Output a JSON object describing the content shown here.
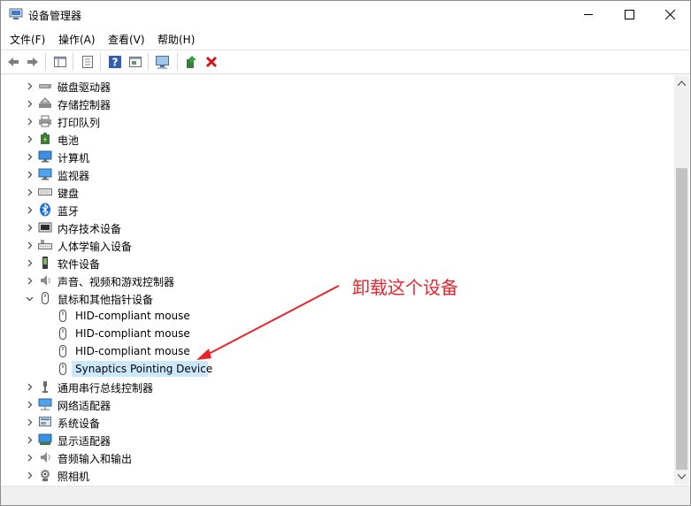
{
  "window": {
    "title": "设备管理器"
  },
  "menu": [
    {
      "label": "文件(F)"
    },
    {
      "label": "操作(A)"
    },
    {
      "label": "查看(V)"
    },
    {
      "label": "帮助(H)"
    }
  ],
  "tree": [
    {
      "label": "磁盘驱动器",
      "icon": "disk-icon",
      "level": 0,
      "expander": "collapsed"
    },
    {
      "label": "存储控制器",
      "icon": "storage-controller-icon",
      "level": 0,
      "expander": "collapsed"
    },
    {
      "label": "打印队列",
      "icon": "printer-icon",
      "level": 0,
      "expander": "collapsed"
    },
    {
      "label": "电池",
      "icon": "battery-icon",
      "level": 0,
      "expander": "collapsed"
    },
    {
      "label": "计算机",
      "icon": "computer-icon",
      "level": 0,
      "expander": "collapsed"
    },
    {
      "label": "监视器",
      "icon": "monitor-icon",
      "level": 0,
      "expander": "collapsed"
    },
    {
      "label": "键盘",
      "icon": "keyboard-icon",
      "level": 0,
      "expander": "collapsed"
    },
    {
      "label": "蓝牙",
      "icon": "bluetooth-icon",
      "level": 0,
      "expander": "collapsed"
    },
    {
      "label": "内存技术设备",
      "icon": "memory-device-icon",
      "level": 0,
      "expander": "collapsed"
    },
    {
      "label": "人体学输入设备",
      "icon": "hid-icon",
      "level": 0,
      "expander": "collapsed"
    },
    {
      "label": "软件设备",
      "icon": "software-device-icon",
      "level": 0,
      "expander": "collapsed"
    },
    {
      "label": "声音、视频和游戏控制器",
      "icon": "speaker-icon",
      "level": 0,
      "expander": "collapsed"
    },
    {
      "label": "鼠标和其他指针设备",
      "icon": "mouse-icon",
      "level": 0,
      "expander": "expanded"
    },
    {
      "label": "HID-compliant mouse",
      "icon": "mouse-icon",
      "level": 1,
      "expander": "none"
    },
    {
      "label": "HID-compliant mouse",
      "icon": "mouse-icon",
      "level": 1,
      "expander": "none"
    },
    {
      "label": "HID-compliant mouse",
      "icon": "mouse-icon",
      "level": 1,
      "expander": "none"
    },
    {
      "label": "Synaptics Pointing Device",
      "icon": "mouse-icon",
      "level": 1,
      "expander": "none",
      "selected": true
    },
    {
      "label": "通用串行总线控制器",
      "icon": "usb-icon",
      "level": 0,
      "expander": "collapsed"
    },
    {
      "label": "网络适配器",
      "icon": "network-adapter-icon",
      "level": 0,
      "expander": "collapsed"
    },
    {
      "label": "系统设备",
      "icon": "system-device-icon",
      "level": 0,
      "expander": "collapsed"
    },
    {
      "label": "显示适配器",
      "icon": "display-adapter-icon",
      "level": 0,
      "expander": "collapsed"
    },
    {
      "label": "音频输入和输出",
      "icon": "audio-io-icon",
      "level": 0,
      "expander": "collapsed"
    },
    {
      "label": "照相机",
      "icon": "camera-icon",
      "level": 0,
      "expander": "collapsed"
    }
  ],
  "annotation": {
    "text": "卸载这个设备",
    "color": "#e8252b"
  },
  "colors": {
    "selection": "#cce8ff",
    "accent": "#e8252b"
  }
}
